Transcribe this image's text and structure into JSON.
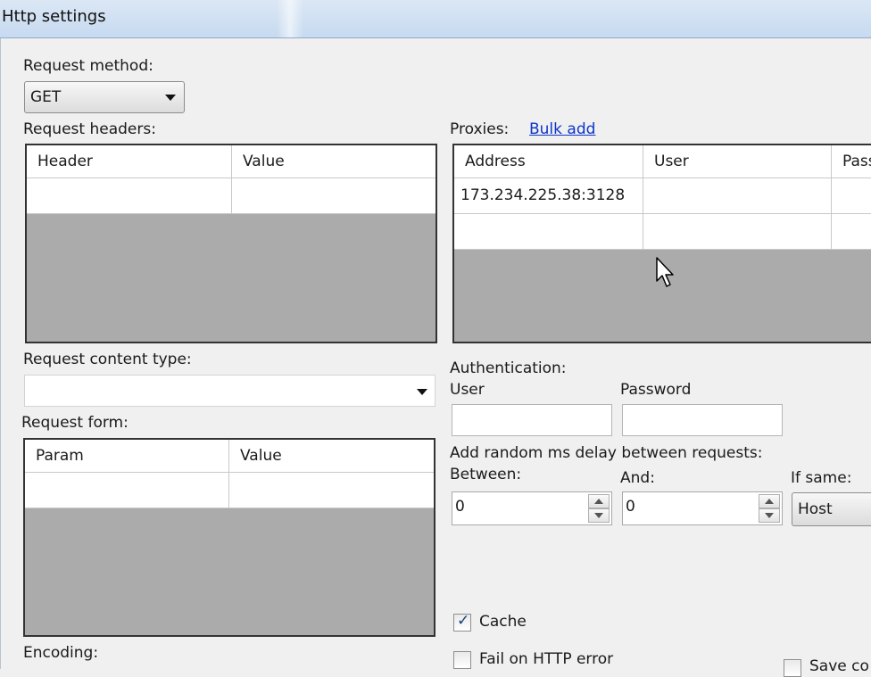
{
  "window": {
    "title": "Http settings"
  },
  "request_method": {
    "label": "Request method:",
    "value": "GET"
  },
  "request_headers": {
    "label": "Request headers:",
    "columns": [
      "Header",
      "Value"
    ],
    "rows": [
      [
        "",
        ""
      ]
    ]
  },
  "proxies": {
    "label": "Proxies:",
    "bulk_add": "Bulk add",
    "columns": [
      "Address",
      "User",
      "Pass"
    ],
    "rows": [
      [
        "173.234.225.38:3128",
        "",
        ""
      ],
      [
        "",
        "",
        ""
      ]
    ]
  },
  "request_content_type": {
    "label": "Request content type:",
    "value": ""
  },
  "authentication": {
    "label": "Authentication:",
    "user_label": "User",
    "password_label": "Password",
    "user_value": "",
    "password_value": ""
  },
  "request_form": {
    "label": "Request form:",
    "columns": [
      "Param",
      "Value"
    ],
    "rows": [
      [
        "",
        ""
      ]
    ]
  },
  "delay": {
    "label": "Add random ms delay between requests:",
    "between_label": "Between:",
    "between_value": "0",
    "and_label": "And:",
    "and_value": "0",
    "if_same_label": "If same:",
    "if_same_value": "Host"
  },
  "options": {
    "cache_label": "Cache",
    "cache_checked": true,
    "fail_label": "Fail on HTTP error",
    "fail_checked": false,
    "save_label": "Save co"
  },
  "encoding": {
    "label": "Encoding:"
  }
}
